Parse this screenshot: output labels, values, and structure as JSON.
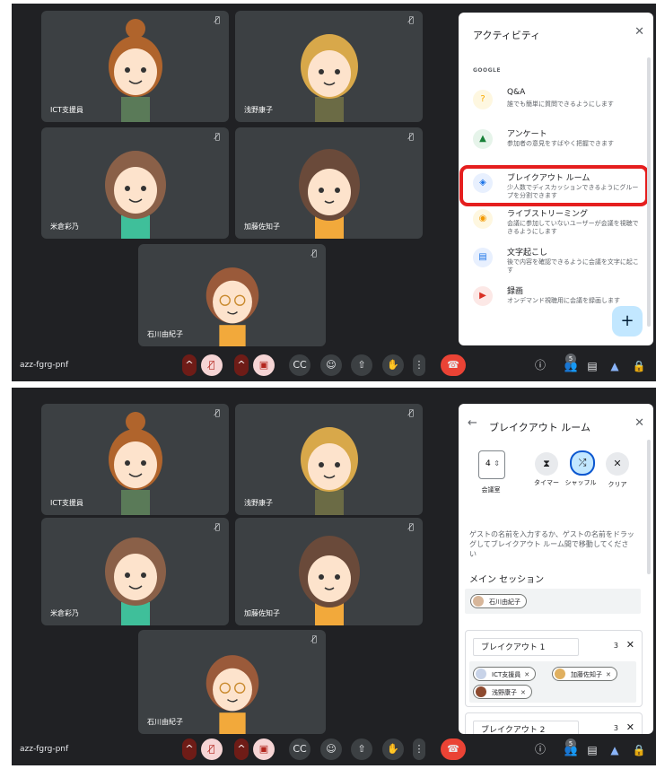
{
  "meeting_code": "azz-fgrg-pnf",
  "participants": {
    "ict": "ICT支援員",
    "asano": "浅野康子",
    "yonekura": "米倉彩乃",
    "kato": "加藤佐知子",
    "ishikawa": "石川由紀子"
  },
  "people_count": "5",
  "activities_panel": {
    "title": "アクティビティ",
    "section": "GOOGLE",
    "items": [
      {
        "title": "Q&A",
        "desc": "誰でも簡単に質問できるようにします"
      },
      {
        "title": "アンケート",
        "desc": "参加者の意見をすばやく把握できます"
      },
      {
        "title": "ブレイクアウト ルーム",
        "desc": "少人数でディスカッションできるようにグループを分割できます"
      },
      {
        "title": "ライブストリーミング",
        "desc": "会議に参加していないユーザーが会議を視聴できるようにします"
      },
      {
        "title": "文字起こし",
        "desc": "後で内容を確認できるように会議を文字に起こす"
      },
      {
        "title": "録画",
        "desc": "オンデマンド視聴用に会議を録画します"
      }
    ]
  },
  "breakout_panel": {
    "title": "ブレイクアウト ルーム",
    "room_count": "4",
    "room_label": "会議室",
    "timer_label": "タイマー",
    "shuffle_label": "シャッフル",
    "clear_label": "クリア",
    "instructions": "ゲストの名前を入力するか、ゲストの名前をドラッグしてブレイクアウト ルーム間で移動してください",
    "main_session": "メイン セッション",
    "room1": {
      "name": "ブレイクアウト 1",
      "count": "3"
    },
    "room2": {
      "name": "ブレイクアウト 2",
      "count": "3"
    }
  }
}
